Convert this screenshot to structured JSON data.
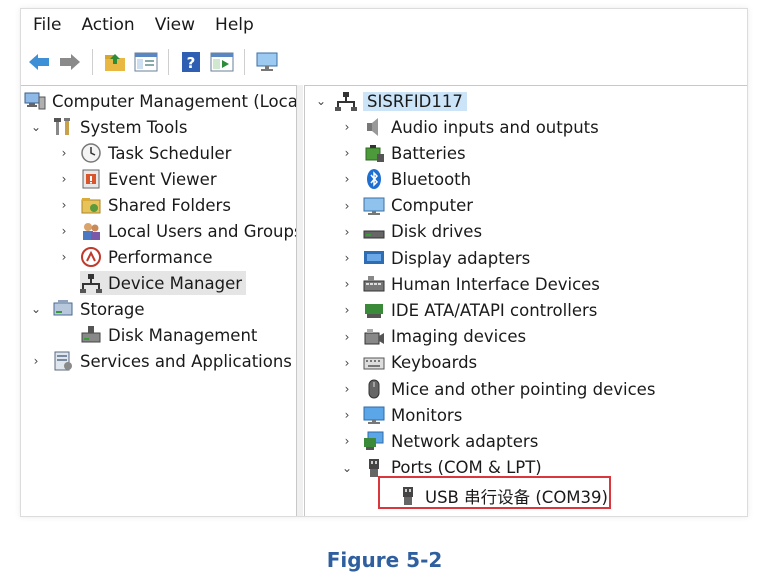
{
  "menu": [
    "File",
    "Action",
    "View",
    "Help"
  ],
  "toolbar": {
    "buttons": [
      "back-arrow-icon",
      "forward-arrow-icon",
      "up-folder-icon",
      "show-hide-tree-icon",
      "help-icon",
      "properties-icon",
      "monitor-icon"
    ]
  },
  "left_tree": {
    "root": "Computer Management (Local)",
    "system_tools": "System Tools",
    "task_scheduler": "Task Scheduler",
    "event_viewer": "Event Viewer",
    "shared_folders": "Shared Folders",
    "local_users": "Local Users and Groups",
    "performance": "Performance",
    "device_manager": "Device Manager",
    "storage": "Storage",
    "disk_management": "Disk Management",
    "services": "Services and Applications"
  },
  "device_tree": {
    "root": "SISRFID117",
    "categories": [
      "Audio inputs and outputs",
      "Batteries",
      "Bluetooth",
      "Computer",
      "Disk drives",
      "Display adapters",
      "Human Interface Devices",
      "IDE ATA/ATAPI controllers",
      "Imaging devices",
      "Keyboards",
      "Mice and other pointing devices",
      "Monitors",
      "Network adapters",
      "Ports (COM & LPT)"
    ],
    "port_child": "USB 串行设备 (COM39)"
  },
  "caption": "Figure 5-2",
  "colors": {
    "highlight": "#d9363e",
    "caption": "#2f5f9e",
    "selection": "#cce4f7"
  }
}
